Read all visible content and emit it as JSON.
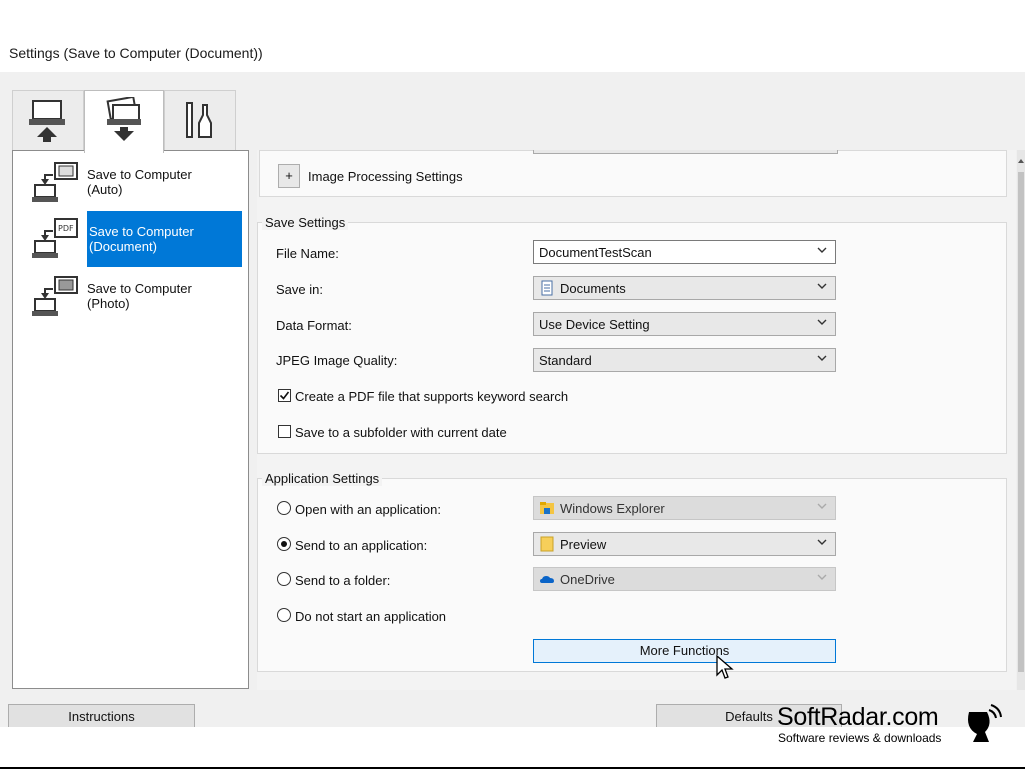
{
  "window": {
    "title": "Settings (Save to Computer (Document))"
  },
  "tabs": [
    {
      "name": "scan-from-computer-tab",
      "icon": "computer-icon"
    },
    {
      "name": "save-settings-tab",
      "icon": "scanner-icon",
      "active": true
    },
    {
      "name": "general-settings-tab",
      "icon": "tools-icon"
    }
  ],
  "sidebar": {
    "items": [
      {
        "label": "Save to Computer (Auto)",
        "line1": "Save to Computer",
        "line2": "(Auto)"
      },
      {
        "label": "Save to Computer (Document)",
        "line1": "Save to Computer",
        "line2": "(Document)",
        "selected": true
      },
      {
        "label": "Save to Computer (Photo)",
        "line1": "Save to Computer",
        "line2": "(Photo)"
      }
    ]
  },
  "image_processing": {
    "expand_label": "+",
    "label": "Image Processing Settings"
  },
  "save_settings": {
    "group_label": "Save Settings",
    "file_name": {
      "label": "File Name:",
      "value": "DocumentTestScan"
    },
    "save_in": {
      "label": "Save in:",
      "value": "Documents"
    },
    "data_format": {
      "label": "Data Format:",
      "value": "Use Device Setting"
    },
    "jpeg_quality": {
      "label": "JPEG Image Quality:",
      "value": "Standard"
    },
    "pdf_keyword": {
      "label": "Create a PDF file that supports keyword search",
      "checked": true
    },
    "subfolder": {
      "label": "Save to a subfolder with current date",
      "checked": false
    }
  },
  "application_settings": {
    "group_label": "Application Settings",
    "open_with": {
      "label": "Open with an application:",
      "value": "Windows Explorer",
      "selected": false
    },
    "send_to_app": {
      "label": "Send to an application:",
      "value": "Preview",
      "selected": true
    },
    "send_to_folder": {
      "label": "Send to a folder:",
      "value": "OneDrive",
      "selected": false
    },
    "no_app": {
      "label": "Do not start an application",
      "selected": false
    },
    "more_functions_label": "More Functions"
  },
  "footer": {
    "instructions_label": "Instructions",
    "defaults_label": "Defaults"
  },
  "watermark": {
    "brand": "SoftRadar.com",
    "tagline": "Software reviews & downloads"
  },
  "colors": {
    "selection": "#0078d7",
    "window_bg": "#f0f0f0",
    "accent_button": "#e5f1fb"
  }
}
